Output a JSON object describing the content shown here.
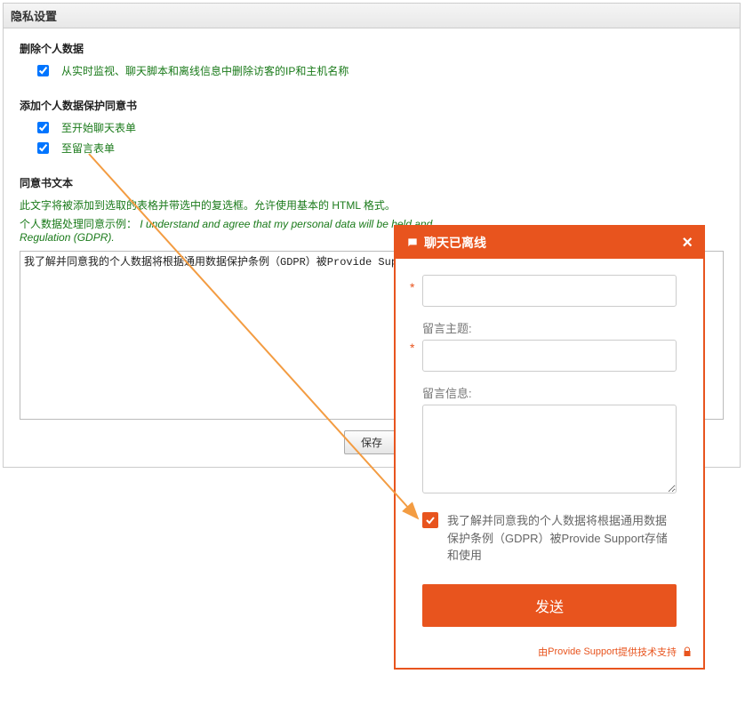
{
  "panel": {
    "title": "隐私设置",
    "section1": {
      "title": "删除个人数据",
      "item1": "从实时监视、聊天脚本和离线信息中删除访客的IP和主机名称"
    },
    "section2": {
      "title": "添加个人数据保护同意书",
      "item1": "至开始聊天表单",
      "item2": "至留言表单"
    },
    "section3": {
      "title": "同意书文本",
      "desc": "此文字将被添加到选取的表格并带选中的复选框。允许使用基本的 HTML 格式。",
      "example_prefix": "个人数据处理同意示例：",
      "example_italic": "I understand and agree that my personal data will be held and",
      "example_suffix": "Regulation (GDPR).",
      "textarea_content": "我了解并同意我的个人数据将根据通用数据保护条例（GDPR）被Provide Supp"
    },
    "save_button": "保存"
  },
  "chat": {
    "title": "聊天已离线",
    "subject_label": "留言主题:",
    "message_label": "留言信息:",
    "consent_text": "我了解并同意我的个人数据将根据通用数据保护条例（GDPR）被Provide Support存储和使用",
    "send_button": "发送",
    "footer_prefix": "由 ",
    "footer_brand": "Provide Support",
    "footer_suffix": " 提供技术支持"
  }
}
